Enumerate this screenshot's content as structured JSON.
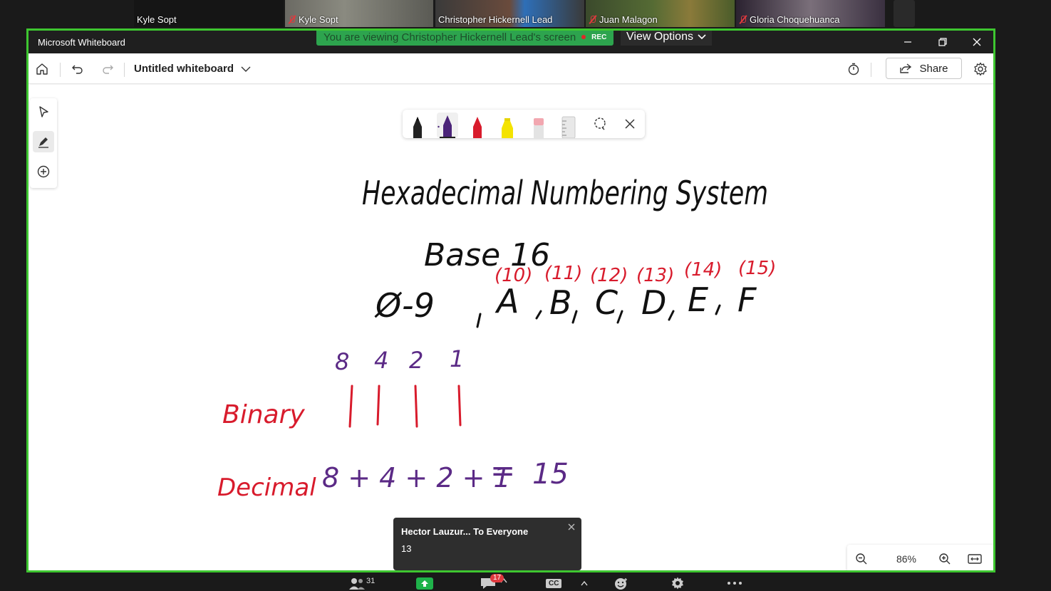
{
  "participants": [
    {
      "name": "Kyle Sopt",
      "muted": false
    },
    {
      "name": "Kyle Sopt",
      "muted": true
    },
    {
      "name": "Christopher Hickernell Lead",
      "muted": false
    },
    {
      "name": "Juan Malagon",
      "muted": true
    },
    {
      "name": "Gloria Choquehuanca",
      "muted": true
    }
  ],
  "share": {
    "banner_text": "You are viewing Christopher Hickernell Lead's screen",
    "rec_label": "REC",
    "view_options_label": "View Options"
  },
  "window": {
    "app_title": "Microsoft Whiteboard",
    "controls": [
      "minimize-icon",
      "restore-icon",
      "close-icon"
    ]
  },
  "toolbar": {
    "board_title": "Untitled whiteboard",
    "share_label": "Share"
  },
  "ink_tray": {
    "tools": [
      "black-pen",
      "purple-pen",
      "red-pen",
      "yellow-highlighter",
      "eraser",
      "ruler",
      "lasso",
      "close"
    ],
    "selected": "purple-pen"
  },
  "whiteboard": {
    "title": "Hexadecimal Numbering System",
    "subtitle": "Base 16",
    "digits": [
      "Ø-9",
      "A",
      "B",
      "C",
      "D",
      "E",
      "F"
    ],
    "digit_values": [
      "(10)",
      "(11)",
      "(12)",
      "(13)",
      "(14)",
      "(15)"
    ],
    "place_values": [
      "8",
      "4",
      "2",
      "1"
    ],
    "binary_label": "Binary",
    "binary_bits": [
      "|",
      "|",
      "|",
      "|"
    ],
    "decimal_label": "Decimal",
    "decimal_expression": "8 + 4 + 2 + 1",
    "decimal_equals": "=",
    "decimal_result": "15",
    "ink_colors": {
      "black": "#111111",
      "red": "#d81b2c",
      "purple": "#5b2a86"
    }
  },
  "chat_toast": {
    "from": "Hector Lauzur... To Everyone",
    "message": "13"
  },
  "zoom": {
    "level": "86%"
  },
  "meeting_bar": {
    "participant_count": "31",
    "chat_badge": "17",
    "cc_label": "CC"
  },
  "colors": {
    "share_border": "#3ec630",
    "banner_bg": "#2da44e",
    "titlebar_bg": "#1f1f1f"
  }
}
